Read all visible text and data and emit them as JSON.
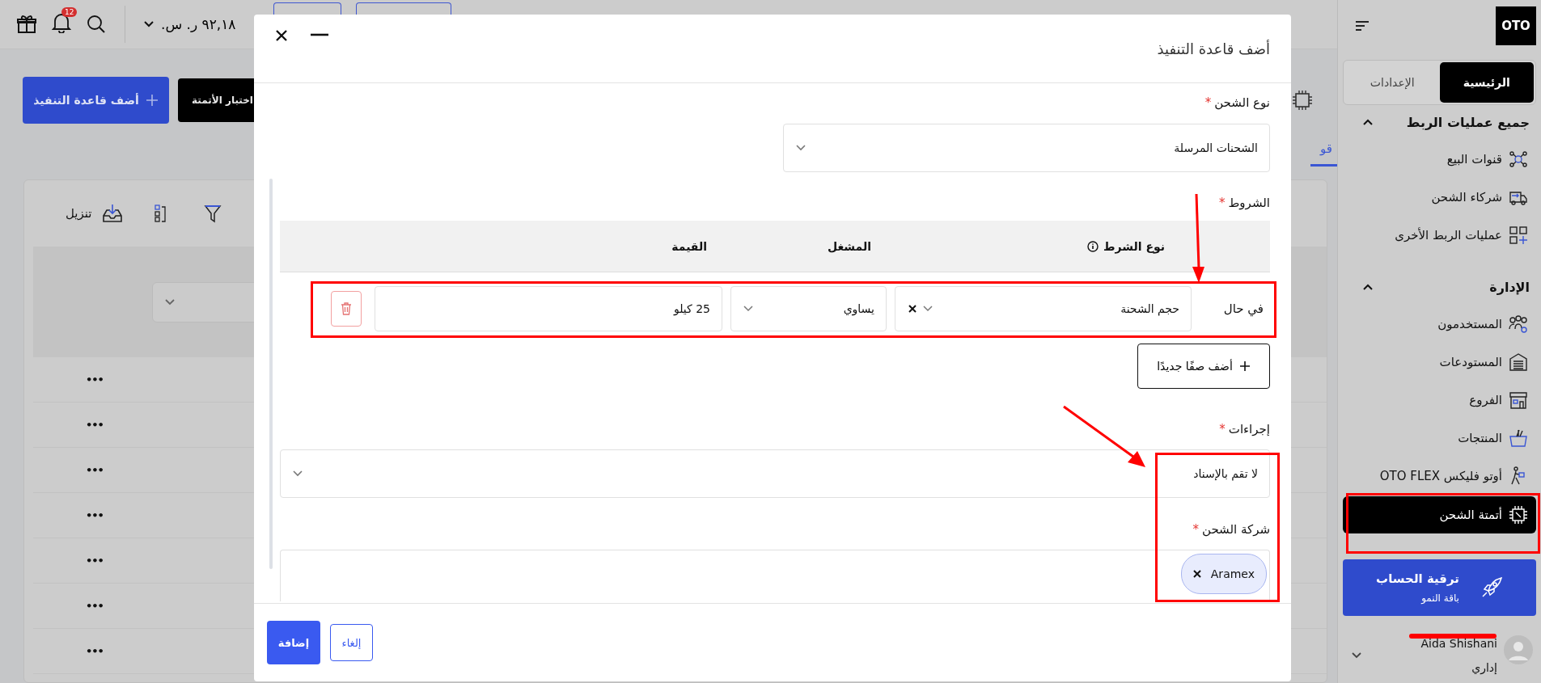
{
  "header": {
    "balance": "٩٢,١٨ ر. س.",
    "notifications": "12"
  },
  "page": {
    "add_button": "أضف قاعدة التنفيذ",
    "test_button": "اختبار الأتمتة",
    "tab": {
      "label": "قو",
      "selected": true
    },
    "download": "تنزيل",
    "rows": [
      "•••",
      "•••",
      "•••",
      "•••",
      "•••",
      "•••",
      "•••"
    ]
  },
  "modal": {
    "title": "أضف قاعدة التنفيذ",
    "shipment_type": {
      "label": "نوع الشحن",
      "mark": "*",
      "value": "الشحنات المرسلة"
    },
    "conditions": {
      "label": "الشروط",
      "mark": "*",
      "columns": [
        "نوع الشرط",
        "المشغل",
        "القيمة"
      ],
      "rows": [
        {
          "prefix": "في حال",
          "type": "حجم الشحنة",
          "operator": "يساوي",
          "value": "25 كيلو"
        }
      ],
      "add_row": "أضف صفًا جديدًا"
    },
    "actions": {
      "label": "إجراءات",
      "mark": "*",
      "value": "لا تقم بالإسناد"
    },
    "carrier": {
      "label": "شركة الشحن",
      "mark": "*",
      "tags": [
        "Aramex"
      ]
    },
    "buttons": {
      "submit": "إضافة",
      "cancel": "إلغاء"
    }
  },
  "sidebar": {
    "logo": "OTO",
    "tabs": [
      {
        "label": "الرئيسية",
        "selected": true
      },
      {
        "label": "الإعدادات",
        "selected": false
      }
    ],
    "sections": [
      {
        "title": "جميع عمليات الربط",
        "expanded": true,
        "items": [
          {
            "label": "قنوات البيع",
            "selected": false
          },
          {
            "label": "شركاء الشحن",
            "selected": false
          },
          {
            "label": "عمليات الربط الأخرى",
            "selected": false
          }
        ]
      },
      {
        "title": "الإدارة",
        "expanded": true,
        "items": [
          {
            "label": "المستخدمون",
            "selected": false
          },
          {
            "label": "المستودعات",
            "selected": false
          },
          {
            "label": "الفروع",
            "selected": false
          },
          {
            "label": "المنتجات",
            "selected": false
          },
          {
            "label": "أوتو فليكس OTO FLEX",
            "selected": false
          },
          {
            "label": "أتمتة الشحن",
            "selected": true
          }
        ]
      }
    ],
    "upgrade": {
      "title": "ترقية الحساب",
      "subtitle": "باقة النمو"
    },
    "user": {
      "name": "Aida Shishani",
      "role": "إداري"
    }
  }
}
